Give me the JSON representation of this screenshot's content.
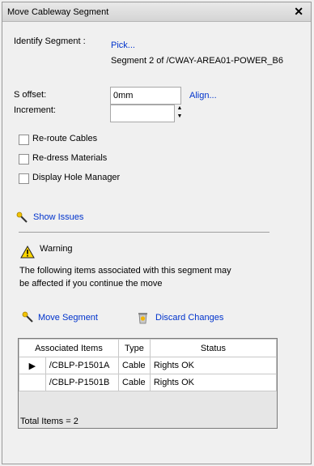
{
  "window": {
    "title": "Move Cableway Segment"
  },
  "identify": {
    "label": "Identify Segment :",
    "pick_link": "Pick...",
    "segment_text": "Segment 2 of /CWAY-AREA01-POWER_B6"
  },
  "offset": {
    "s_offset_label": "S offset:",
    "s_offset_value": "0mm",
    "align_link": "Align...",
    "increment_label": "Increment:",
    "increment_value": ""
  },
  "options": [
    {
      "label": "Re-route Cables",
      "checked": false
    },
    {
      "label": "Re-dress Materials",
      "checked": false
    },
    {
      "label": "Display Hole Manager",
      "checked": false
    }
  ],
  "show_issues": {
    "label": "Show Issues",
    "icon": "wand-icon"
  },
  "warning": {
    "title": "Warning",
    "line1": "The following items associated with this segment may",
    "line2": "be affected if you continue the move",
    "icon": "warning-icon"
  },
  "actions": {
    "move_segment": "Move Segment",
    "discard_changes": "Discard Changes"
  },
  "table": {
    "columns": [
      "Associated Items",
      "Type",
      "Status"
    ],
    "rows": [
      {
        "item": "/CBLP-P1501A",
        "type": "Cable",
        "status": "Rights OK",
        "current": true
      },
      {
        "item": "/CBLP-P1501B",
        "type": "Cable",
        "status": "Rights OK",
        "current": false
      }
    ],
    "total": "Total Items = 2"
  }
}
